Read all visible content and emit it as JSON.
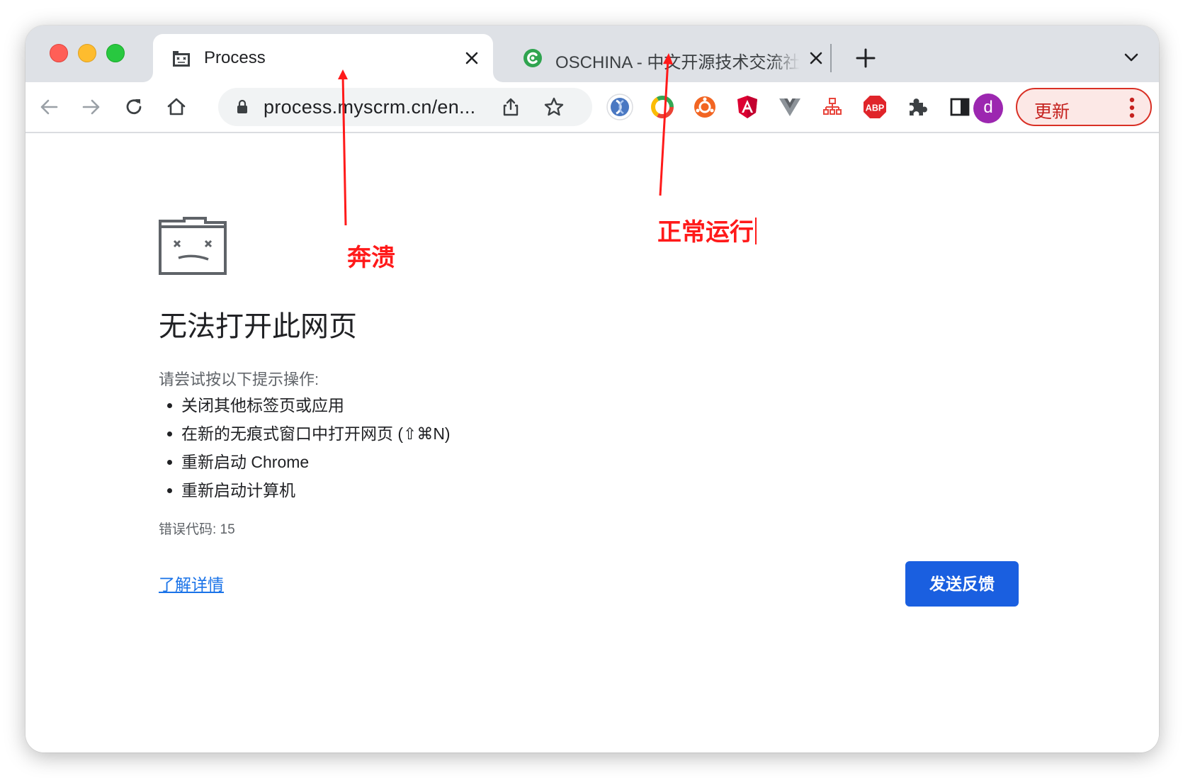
{
  "browser": {
    "tabs": [
      {
        "title": "Process",
        "favicon": "sad-tab-icon",
        "active": true
      },
      {
        "title": "OSCHINA - 中文开源技术交流社区",
        "favicon": "oschina-icon",
        "active": false
      }
    ],
    "address_bar": {
      "url": "process.myscrm.cn/en..."
    },
    "extensions": [
      "blue-sphere-extension-icon",
      "chrome-ring-extension-icon",
      "orange-lifebuoy-extension-icon",
      "angular-extension-icon",
      "vue-extension-icon",
      "tree-extension-icon",
      "abp-extension-icon"
    ],
    "abp_label": "ABP",
    "avatar_letter": "d",
    "update_label": "更新"
  },
  "error_page": {
    "heading": "无法打开此网页",
    "subheading": "请尝试按以下提示操作:",
    "suggestions": [
      "关闭其他标签页或应用",
      "在新的无痕式窗口中打开网页 (⇧⌘N)",
      "重新启动 Chrome",
      "重新启动计算机"
    ],
    "error_code": "错误代码: 15",
    "learn_more": "了解详情",
    "feedback_button": "发送反馈"
  },
  "annotations": {
    "crashed_label": "奔溃",
    "running_label": "正常运行",
    "color": "#ff1a1a"
  },
  "colors": {
    "tabbar_bg": "#dee1e6",
    "accent_blue": "#1a5fe0",
    "link_blue": "#1a73e8",
    "avatar_purple": "#9c27b0",
    "update_red": "#d93025"
  }
}
